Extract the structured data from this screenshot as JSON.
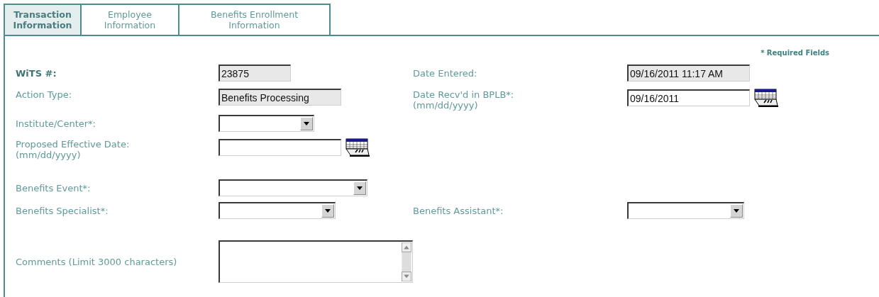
{
  "tabs": [
    {
      "label": "Transaction Information",
      "selected": true
    },
    {
      "label": "Employee Information",
      "selected": false
    },
    {
      "label": "Benefits Enrollment Information",
      "selected": false
    }
  ],
  "required_note": "* Required Fields",
  "rows": [
    {
      "fields": [
        {
          "label": "WiTS #:",
          "emphasis": true,
          "kind": "readonly",
          "value": "23875"
        },
        {
          "label": "Date Entered:",
          "emphasis": false,
          "kind": "readonly",
          "value": "09/16/2011 11:17 AM"
        }
      ]
    },
    {
      "fields": [
        {
          "label": "Action Type:",
          "emphasis": false,
          "kind": "readonly",
          "value": "Benefits Processing"
        },
        {
          "label": "Date Recv'd in BPLB*:",
          "hint": "(mm/dd/yyyy)",
          "emphasis": false,
          "kind": "date",
          "value": "09/16/2011"
        }
      ]
    },
    {
      "fields": [
        {
          "label": "Institute/Center*:",
          "emphasis": false,
          "kind": "select"
        }
      ]
    },
    {
      "fields": [
        {
          "label": "Proposed Effective Date:",
          "hint": "(mm/dd/yyyy)",
          "emphasis": false,
          "kind": "date"
        }
      ]
    },
    {
      "fields": [
        {
          "label": "Benefits Event*:",
          "emphasis": false,
          "kind": "select"
        }
      ]
    },
    {
      "fields": [
        {
          "label": "Benefits Specialist*:",
          "emphasis": false,
          "kind": "select"
        },
        {
          "label": "Benefits Assistant*:",
          "emphasis": false,
          "kind": "select"
        }
      ]
    },
    {
      "fields": [
        {
          "label": "Comments (Limit 3000 characters)",
          "emphasis": false,
          "kind": "textarea"
        }
      ]
    }
  ]
}
